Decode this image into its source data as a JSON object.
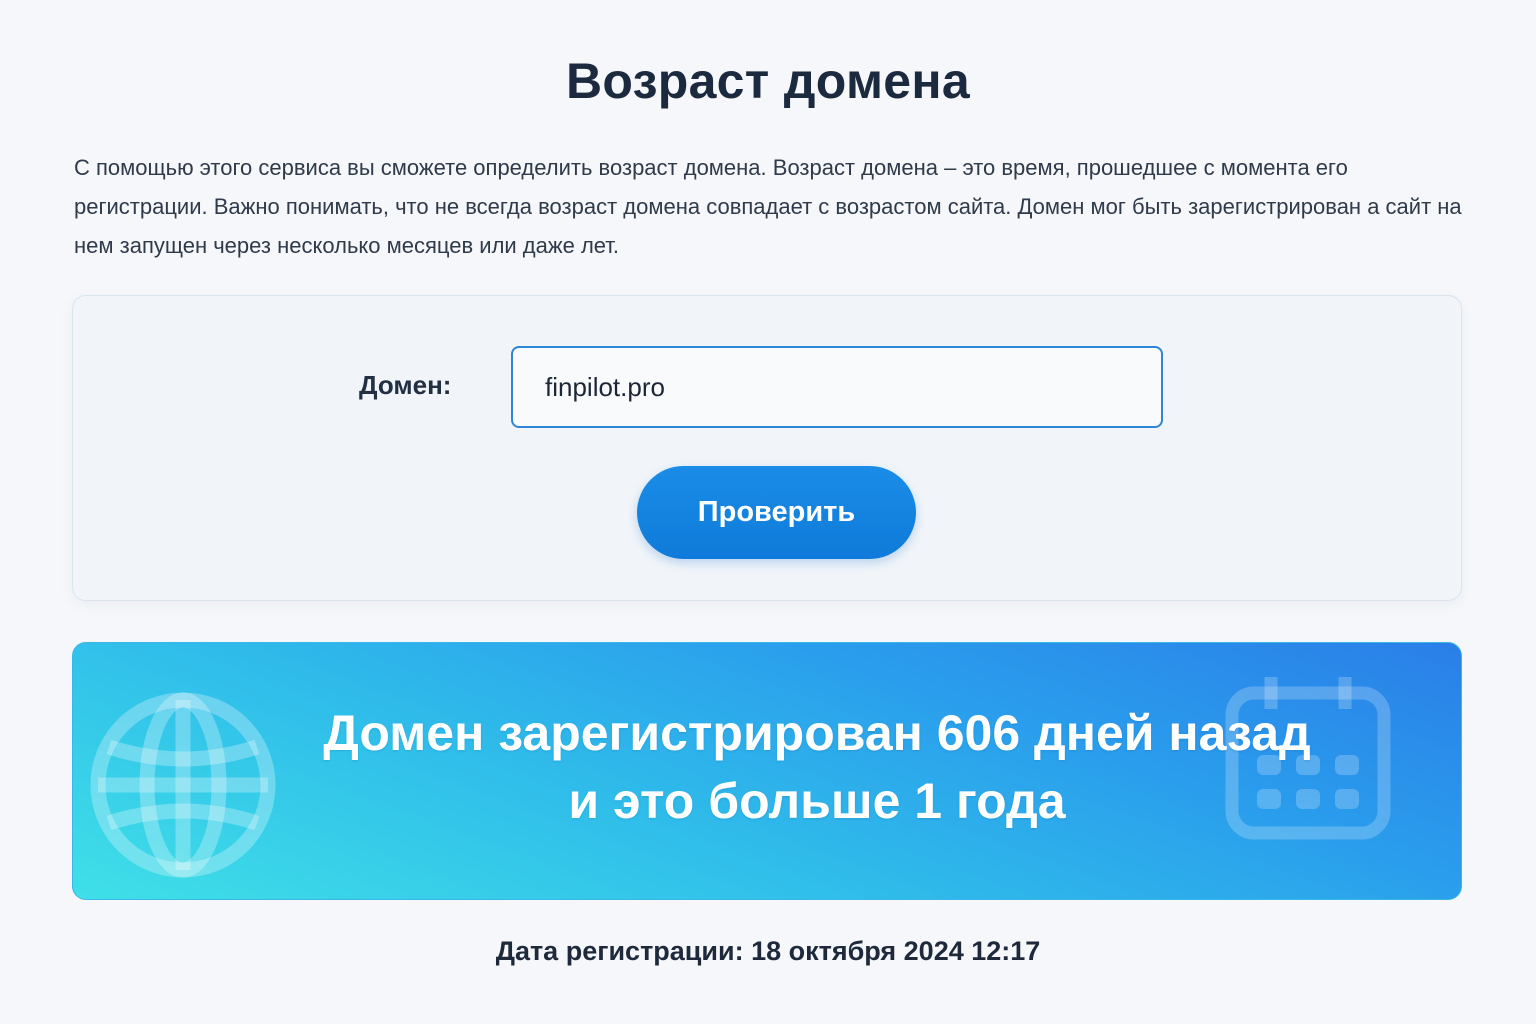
{
  "page": {
    "title": "Возраст домена",
    "intro": "С помощью этого сервиса вы сможете определить возраст домена. Возраст домена – это время, прошедшее с момента его регистрации. Важно понимать, что не всегда возраст домена совпадает с возрастом сайта. Домен мог быть зарегистрирован а сайт на нем запущен через несколько месяцев или даже лет."
  },
  "form": {
    "domain_label": "Домен:",
    "domain_value": "finpilot.pro",
    "submit_label": "Проверить"
  },
  "result": {
    "line1": "Домен зарегистрирован 606 дней назад",
    "line2": "и это больше 1 года",
    "left_icon": "globe-icon",
    "right_icon": "calendar-icon"
  },
  "registration": {
    "text": "Дата регистрации: 18 октября 2024 12:17"
  },
  "colors": {
    "accent": "#1a8de8",
    "input_border": "#2f86d6",
    "banner_start": "#3fe0e8",
    "banner_end": "#2a7fe8",
    "page_bg": "#f5f7fa"
  }
}
